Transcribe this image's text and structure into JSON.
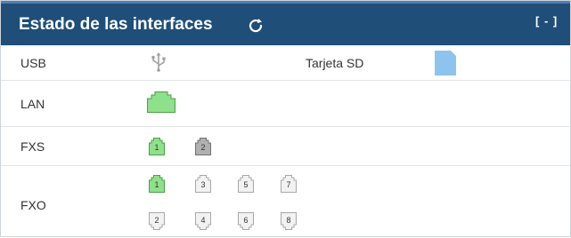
{
  "header": {
    "title": "Estado de las interfaces",
    "collapse_label": "[ - ]"
  },
  "rows": {
    "usb": {
      "label": "USB",
      "sd_label": "Tarjeta SD"
    },
    "lan": {
      "label": "LAN"
    },
    "fxs": {
      "label": "FXS",
      "ports": [
        "1",
        "2"
      ]
    },
    "fxo": {
      "label": "FXO",
      "ports_top": [
        "1",
        "3",
        "5",
        "7"
      ],
      "ports_bottom": [
        "2",
        "4",
        "6",
        "8"
      ]
    }
  },
  "colors": {
    "header_bg": "#1f4e79",
    "port_active": "#8fe08a",
    "port_inactive": "#f2f2f2",
    "port_disabled": "#b0b0b0",
    "sd_card": "#8cc4ee"
  }
}
